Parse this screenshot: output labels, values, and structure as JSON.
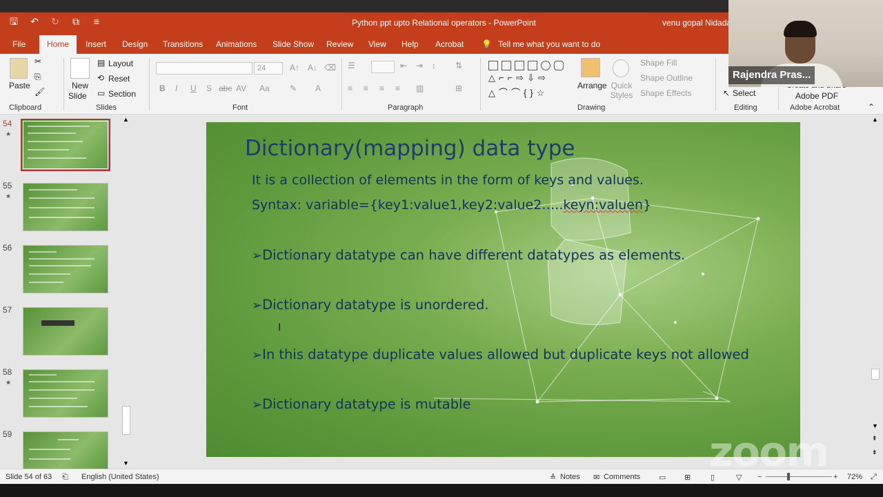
{
  "window": {
    "title": "Python ppt upto Relational operators  -  PowerPoint",
    "user": "venu gopal Nidadal"
  },
  "tabs": [
    "File",
    "Home",
    "Insert",
    "Design",
    "Transitions",
    "Animations",
    "Slide Show",
    "Review",
    "View",
    "Help",
    "Acrobat"
  ],
  "tell_me": "Tell me what you want to do",
  "ribbon": {
    "clipboard": {
      "paste": "Paste",
      "label": "Clipboard"
    },
    "slides": {
      "new_slide": "New",
      "new_slide2": "Slide",
      "layout": "Layout",
      "reset": "Reset",
      "section": "Section",
      "label": "Slides"
    },
    "font": {
      "size": "24",
      "label": "Font",
      "buttons": [
        "B",
        "I",
        "U",
        "S",
        "abc",
        "AV",
        "Aa",
        "A"
      ]
    },
    "paragraph": {
      "label": "Paragraph"
    },
    "drawing": {
      "arrange": "Arrange",
      "quick_styles": "Quick Styles",
      "shape_fill": "Shape Fill",
      "shape_outline": "Shape Outline",
      "shape_effects": "Shape Effects",
      "label": "Drawing"
    },
    "editing": {
      "select": "Select",
      "label": "Editing"
    },
    "adobe": {
      "create_line1": "Create and Share",
      "create_line2": "Adobe PDF",
      "label": "Adobe Acrobat"
    }
  },
  "thumbnails": [
    {
      "num": "54",
      "star": "★",
      "selected": true
    },
    {
      "num": "55",
      "star": "★",
      "selected": false
    },
    {
      "num": "56",
      "star": "",
      "selected": false
    },
    {
      "num": "57",
      "star": "",
      "selected": false
    },
    {
      "num": "58",
      "star": "★",
      "selected": false
    },
    {
      "num": "59",
      "star": "",
      "selected": false
    }
  ],
  "slide": {
    "title": "Dictionary(mapping) data type",
    "line1": "It is a collection of elements in the form of keys and values.",
    "line2_prefix": "Syntax: variable={key1:value1,key2:value2…..",
    "line2_squiggle": "keyn:valuen",
    "line2_suffix": "}",
    "bullets": [
      "Dictionary datatype can have different datatypes as elements.",
      "Dictionary datatype is unordered.",
      "In this datatype duplicate values allowed but duplicate keys not allowed",
      "Dictionary datatype is mutable"
    ],
    "bullet_glyph": "➢"
  },
  "status": {
    "slide_of": "Slide 54 of 63",
    "language": "English (United States)",
    "notes": "Notes",
    "comments": "Comments",
    "zoom": "72%"
  },
  "webcam": {
    "name": "Rajendra Pras..."
  },
  "overlay": {
    "zoom_watermark": "zoom"
  },
  "colors": {
    "accent": "#c43e1c",
    "slide_green": "#5e9a3c",
    "text_navy": "#13325e"
  }
}
